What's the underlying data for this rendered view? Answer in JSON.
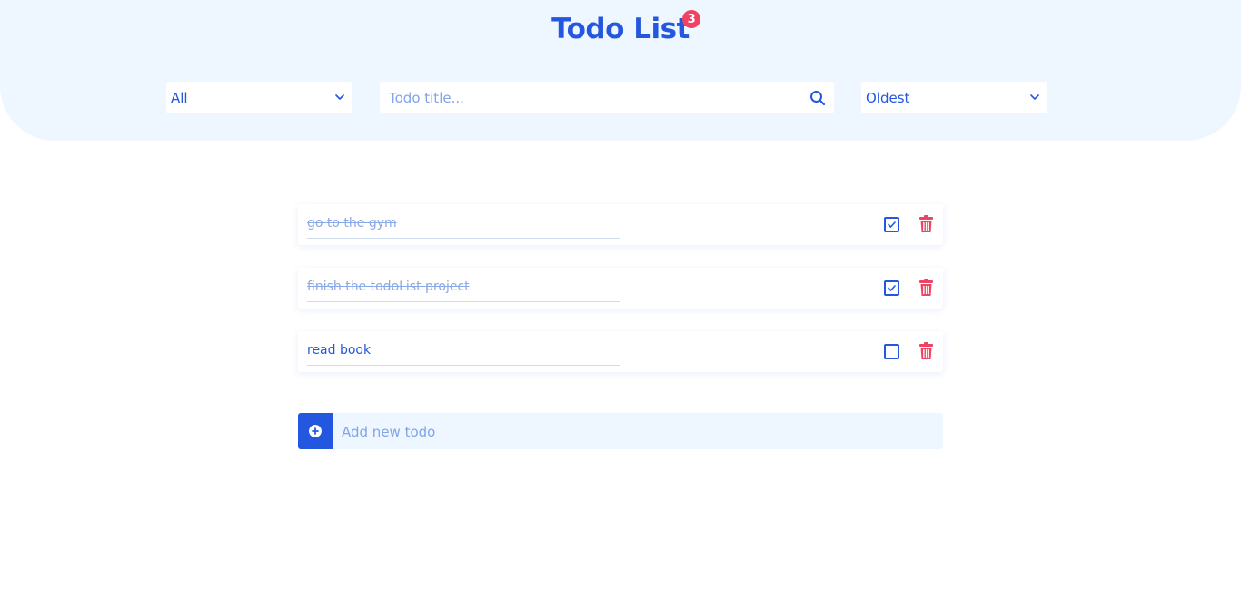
{
  "header": {
    "title": "Todo List",
    "badge_count": "3"
  },
  "filters": {
    "status_selected": "All",
    "search_placeholder": "Todo title...",
    "sort_selected": "Oldest"
  },
  "todos": [
    {
      "title": "go to the gym",
      "completed": true
    },
    {
      "title": "finish the todoList project",
      "completed": true
    },
    {
      "title": "read book",
      "completed": false
    }
  ],
  "add": {
    "placeholder": "Add new todo"
  },
  "colors": {
    "accent": "#2357e0",
    "header_bg": "#eef7ff",
    "danger": "#ef4364"
  }
}
